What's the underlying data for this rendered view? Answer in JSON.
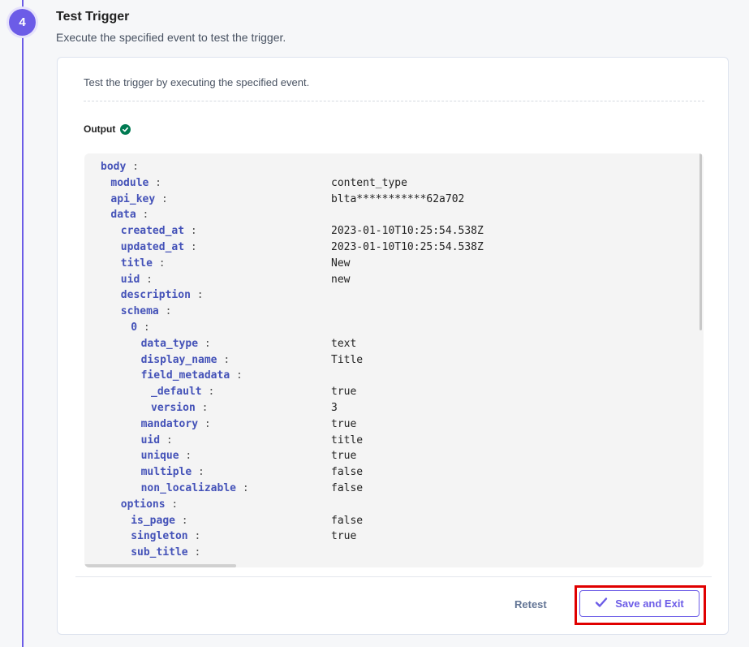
{
  "step": {
    "number": "4",
    "title": "Test Trigger",
    "subtitle": "Execute the specified event to test the trigger."
  },
  "card": {
    "description": "Test the trigger by executing the specified event.",
    "output_label": "Output",
    "output_status": "success"
  },
  "json_rows": [
    {
      "depth": 0,
      "key": "body",
      "value": ""
    },
    {
      "depth": 1,
      "key": "module",
      "value": "content_type"
    },
    {
      "depth": 1,
      "key": "api_key",
      "value": "blta***********62a702"
    },
    {
      "depth": 1,
      "key": "data",
      "value": ""
    },
    {
      "depth": 2,
      "key": "created_at",
      "value": "2023-01-10T10:25:54.538Z"
    },
    {
      "depth": 2,
      "key": "updated_at",
      "value": "2023-01-10T10:25:54.538Z"
    },
    {
      "depth": 2,
      "key": "title",
      "value": "New"
    },
    {
      "depth": 2,
      "key": "uid",
      "value": "new"
    },
    {
      "depth": 2,
      "key": "description",
      "value": ""
    },
    {
      "depth": 2,
      "key": "schema",
      "value": ""
    },
    {
      "depth": 3,
      "key": "0",
      "value": ""
    },
    {
      "depth": 4,
      "key": "data_type",
      "value": "text"
    },
    {
      "depth": 4,
      "key": "display_name",
      "value": "Title"
    },
    {
      "depth": 4,
      "key": "field_metadata",
      "value": ""
    },
    {
      "depth": 5,
      "key": "_default",
      "value": "true"
    },
    {
      "depth": 5,
      "key": "version",
      "value": "3"
    },
    {
      "depth": 4,
      "key": "mandatory",
      "value": "true"
    },
    {
      "depth": 4,
      "key": "uid",
      "value": "title"
    },
    {
      "depth": 4,
      "key": "unique",
      "value": "true"
    },
    {
      "depth": 4,
      "key": "multiple",
      "value": "false"
    },
    {
      "depth": 4,
      "key": "non_localizable",
      "value": "false"
    },
    {
      "depth": 2,
      "key": "options",
      "value": ""
    },
    {
      "depth": 3,
      "key": "is_page",
      "value": "false"
    },
    {
      "depth": 3,
      "key": "singleton",
      "value": "true"
    },
    {
      "depth": 3,
      "key": "sub_title",
      "value": ""
    }
  ],
  "footer": {
    "retest_label": "Retest",
    "save_exit_label": "Save and Exit"
  },
  "colors": {
    "accent": "#6c5ce7",
    "success": "#007a52",
    "highlight": "#e00000"
  }
}
